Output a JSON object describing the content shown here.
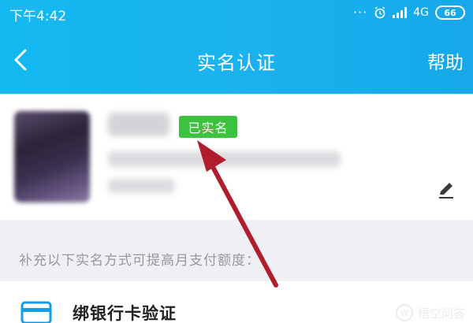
{
  "status_bar": {
    "time": "下午4:42",
    "network": "4G",
    "battery": "66"
  },
  "nav": {
    "title": "实名认证",
    "help_label": "帮助"
  },
  "profile": {
    "verified_badge": "已实名"
  },
  "section": {
    "hint": "补充以下实名方式可提高月支付额度："
  },
  "list": {
    "bank_card_label": "绑银行卡验证"
  },
  "watermark": {
    "text": "悟空问答"
  },
  "colors": {
    "header": "#16b4ee",
    "badge": "#3cc240",
    "annotation_arrow": "#b01e2e"
  }
}
